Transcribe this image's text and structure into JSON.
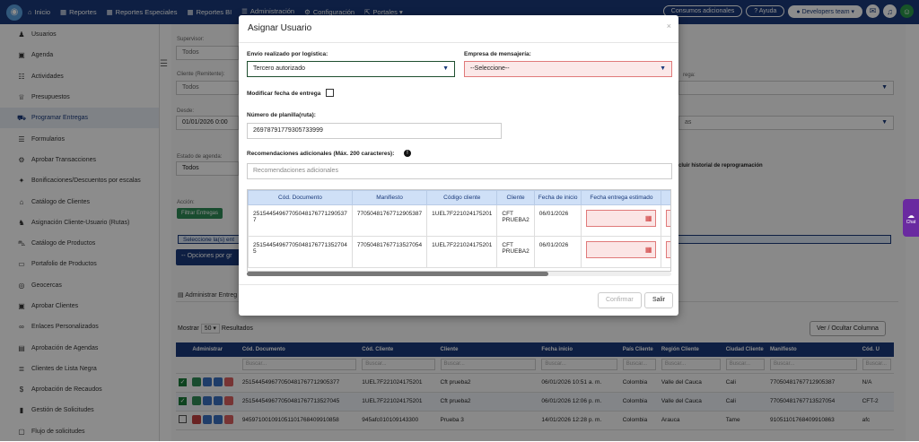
{
  "topbar": {
    "items": [
      {
        "label": "Inicio"
      },
      {
        "label": "Reportes"
      },
      {
        "label": "Reportes Especiales"
      },
      {
        "label": "Reportes BI"
      },
      {
        "label": "Administración"
      },
      {
        "label": "Configuración"
      },
      {
        "label": "Portales"
      }
    ],
    "consumos": "Consumos adicionales",
    "ayuda": "Ayuda",
    "team": "Developers team"
  },
  "sidebar": {
    "items": [
      {
        "label": "Usuarios",
        "icon": "user-icon"
      },
      {
        "label": "Agenda",
        "icon": "calendar-icon"
      },
      {
        "label": "Actividades",
        "icon": "activity-icon"
      },
      {
        "label": "Presupuestos",
        "icon": "trophy-icon"
      },
      {
        "label": "Programar Entregas",
        "icon": "truck-icon"
      },
      {
        "label": "Formularios",
        "icon": "form-icon"
      },
      {
        "label": "Aprobar Transacciones",
        "icon": "gear-icon"
      },
      {
        "label": "Bonificaciones/Descuentos por escalas",
        "icon": "gift-icon"
      },
      {
        "label": "Catálogo de Clientes",
        "icon": "building-icon"
      },
      {
        "label": "Asignación Cliente-Usuario (Rutas)",
        "icon": "users-icon"
      },
      {
        "label": "Catálogo de Productos",
        "icon": "car-icon"
      },
      {
        "label": "Portafolio de Productos",
        "icon": "folder-icon"
      },
      {
        "label": "Geocercas",
        "icon": "geo-icon"
      },
      {
        "label": "Aprobar Clientes",
        "icon": "check-icon"
      },
      {
        "label": "Enlaces Personalizados",
        "icon": "link-icon"
      },
      {
        "label": "Aprobación de Agendas",
        "icon": "agenda-icon"
      },
      {
        "label": "Clientes de Lista Negra",
        "icon": "list-icon"
      },
      {
        "label": "Aprobación de Recaudos",
        "icon": "money-icon"
      },
      {
        "label": "Gestión de Solicitudes",
        "icon": "doc-icon"
      },
      {
        "label": "Flujo de solicitudes",
        "icon": "flow-icon"
      }
    ]
  },
  "background": {
    "supervisor_label": "Supervisor:",
    "supervisor_value": "Todos",
    "cliente_label": "Cliente (Remitente):",
    "cliente_value": "Todos",
    "desde_label": "Desde:",
    "desde_value": "01/01/2026 0:00",
    "estado_label": "Estado de agenda:",
    "estado_value": "Todos",
    "accion_label": "Acción:",
    "filtrar_btn": "Filtrar Entregas",
    "seleccione": "Seleccione la(s) ent",
    "opciones_btn": "-- Opciones por gr",
    "historial": "cluir historial de reprogramación",
    "right_label_1": "rega:",
    "right_label_2": "as",
    "admin_tab": "Administrar Entreg",
    "mostrar": "Mostrar",
    "mostrar_value": "50",
    "resultados": "Resultados",
    "ver_ocultar": "Ver / Ocultar Columna"
  },
  "modal": {
    "title": "Asignar Usuario",
    "envio_label": "Envío realizado por logística:",
    "envio_value": "Tercero autorizado",
    "empresa_label": "Empresa de mensajería:",
    "empresa_value": "--Seleccione--",
    "modificar_label": "Modificar fecha de entrega",
    "planilla_label": "Número de planilla(ruta):",
    "planilla_value": "26978791779305733999",
    "recomend_label": "Recomendaciones adicionales (Máx. 200 caracteres):",
    "recomend_placeholder": "Recomendaciones adicionales",
    "confirmar": "Confirmar",
    "salir": "Salir",
    "table": {
      "headers": [
        "Cód. Documento",
        "Manifiesto",
        "Código cliente",
        "Cliente",
        "Fecha de inicio",
        "Fecha entrega estimado"
      ],
      "rows": [
        [
          "25154454967705048176771290537​7",
          "77050481767712905387",
          "1UEL7F221024175201",
          "CFT PRUEBA2",
          "06/01/2026"
        ],
        [
          "25154454967705048176771352704​5",
          "77050481767713527054",
          "1UEL7F221024175201",
          "CFT PRUEBA2",
          "06/01/2026"
        ]
      ]
    }
  },
  "grid": {
    "headers": [
      "",
      "Administrar",
      "Cód. Documento",
      "Cód. Cliente",
      "Cliente",
      "Fecha inicio",
      "País Cliente",
      "Región Cliente",
      "Ciudad Cliente",
      "Manifiesto",
      "Cód. U"
    ],
    "search": "Buscar...",
    "rows": [
      [
        "251544549677050481767712905377",
        "1UEL7F221024175201",
        "Cft prueba2",
        "06/01/2026 10:51 a. m.",
        "Colombia",
        "Valle del Cauca",
        "Cali",
        "77050481767712905387",
        "N/A"
      ],
      [
        "251544549677050481767713527045",
        "1UEL7F221024175201",
        "Cft prueba2",
        "06/01/2026 12:06 p. m.",
        "Colombia",
        "Valle del Cauca",
        "Cali",
        "77050481767713527054",
        "CFT-2"
      ],
      [
        "94597100109105110176840991085​8",
        "945afc010109143300",
        "Prueba 3",
        "14/01/2026 12:28 p. m.",
        "Colombia",
        "Arauca",
        "Tame",
        "91051101768409910863",
        "afc"
      ]
    ]
  },
  "chat": "Chat"
}
